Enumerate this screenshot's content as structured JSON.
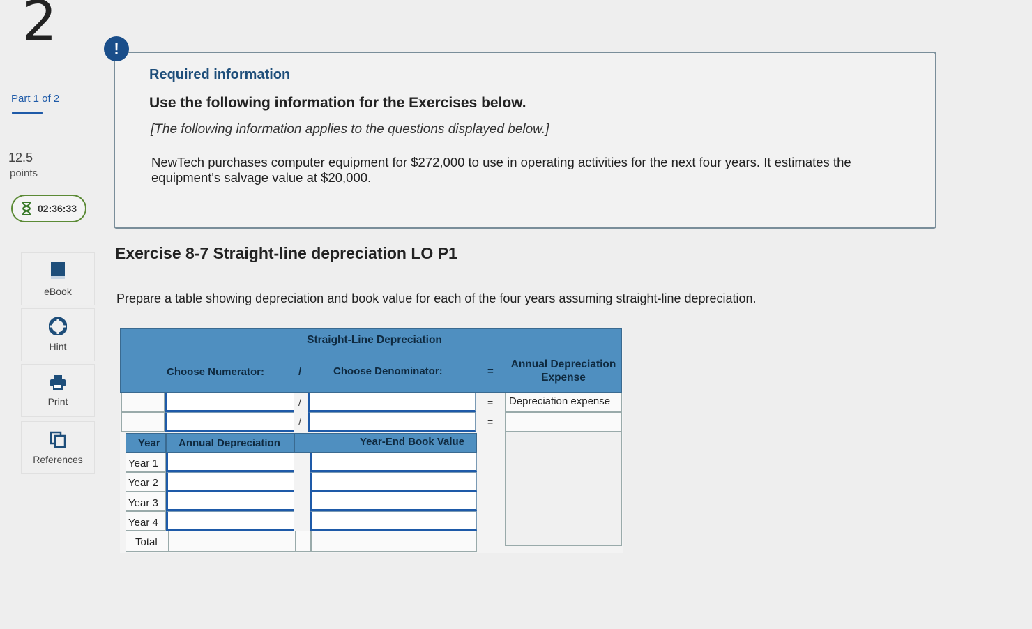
{
  "question": {
    "number": "2"
  },
  "part": {
    "label": "Part 1 of 2"
  },
  "points": {
    "value": "12.5",
    "label": "points"
  },
  "timer": {
    "time": "02:36:33"
  },
  "sidebar": {
    "items": [
      {
        "label": "eBook",
        "icon": "book-icon"
      },
      {
        "label": "Hint",
        "icon": "lifebuoy-icon"
      },
      {
        "label": "Print",
        "icon": "printer-icon"
      },
      {
        "label": "References",
        "icon": "copy-icon"
      }
    ]
  },
  "alert": {
    "symbol": "!"
  },
  "info": {
    "required": "Required information",
    "use": "Use the following information for the Exercises below.",
    "note": "[The following information applies to the questions displayed below.]",
    "description": "NewTech purchases computer equipment for $272,000 to use in operating activities for the next four years. It estimates the equipment's salvage value at $20,000."
  },
  "exercise": {
    "title": "Exercise 8-7 Straight-line depreciation LO P1",
    "prompt": "Prepare a table showing depreciation and book value for each of the four years assuming straight-line depreciation."
  },
  "table": {
    "title": "Straight-Line Depreciation",
    "numerator_header": "Choose Numerator:",
    "divide": "/",
    "denominator_header": "Choose Denominator:",
    "equals": "=",
    "result_header": "Annual Depreciation Expense",
    "row1_result": "Depreciation expense",
    "year_header": "Year",
    "annual_dep_header": "Annual Depreciation",
    "book_value_header": "Year-End Book Value",
    "years": [
      "Year 1",
      "Year 2",
      "Year 3",
      "Year 4"
    ],
    "total": "Total"
  },
  "colors": {
    "accent": "#1e5aa8",
    "header_band": "#4f8fc0",
    "timer_border": "#5b8a35"
  }
}
